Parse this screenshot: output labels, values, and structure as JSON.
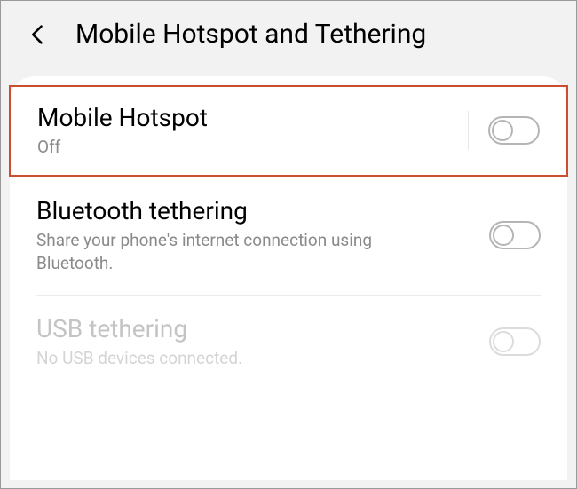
{
  "header": {
    "title": "Mobile Hotspot and Tethering"
  },
  "settings": [
    {
      "title": "Mobile Hotspot",
      "subtitle": "Off",
      "enabled": true,
      "on": false,
      "has_divider": true,
      "highlighted": true
    },
    {
      "title": "Bluetooth tethering",
      "subtitle": "Share your phone's internet connection using Bluetooth.",
      "enabled": true,
      "on": false,
      "has_divider": false,
      "highlighted": false
    },
    {
      "title": "USB tethering",
      "subtitle": "No USB devices connected.",
      "enabled": false,
      "on": false,
      "has_divider": false,
      "highlighted": false
    }
  ]
}
